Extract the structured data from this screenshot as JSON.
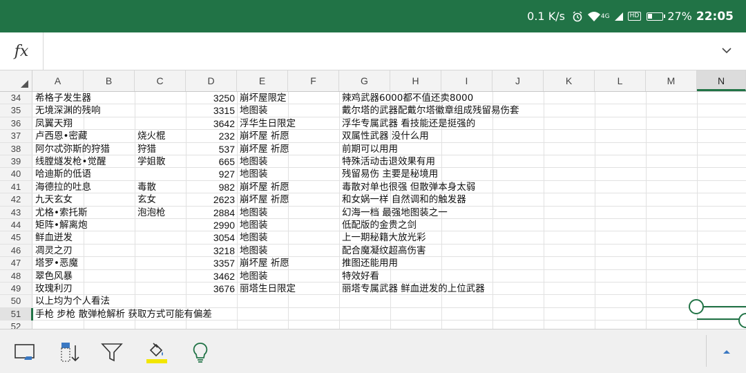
{
  "status_bar": {
    "network_speed": "0.1 K/s",
    "alarm_icon": "alarm-icon",
    "wifi_icon": "wifi-icon",
    "signal_label": "4G",
    "hd_label": "HD",
    "battery": "27%",
    "time": "22:05"
  },
  "formula_bar": {
    "fx_label": "fx",
    "value": "",
    "expand_icon": "chevron-down-icon"
  },
  "columns": [
    "A",
    "B",
    "C",
    "D",
    "E",
    "F",
    "G",
    "H",
    "I",
    "J",
    "K",
    "L",
    "M",
    "N"
  ],
  "selected_column": "N",
  "rows": [
    {
      "num": "34",
      "a": "希格子发生器",
      "c": "",
      "d": "3250",
      "e": "崩坏屋限定",
      "g": "辣鸡武器6000都不值还卖8000"
    },
    {
      "num": "35",
      "a": "无境深渊的残响",
      "c": "",
      "d": "3315",
      "e": "地图装",
      "g": "戴尔塔的武器配戴尔塔徽章组成残留易伤套"
    },
    {
      "num": "36",
      "a": "凤翼天翔",
      "c": "",
      "d": "3642",
      "e": "浮华生日限定",
      "g": "浮华专属武器 看技能还是挺强的"
    },
    {
      "num": "37",
      "a": "卢西恩•密藏",
      "c": "烧火棍",
      "d": "232",
      "e": "崩坏屋 祈愿",
      "g": "双属性武器 没什么用"
    },
    {
      "num": "38",
      "a": "阿尔忒弥斯的狩猎",
      "c": "狩猎",
      "d": "537",
      "e": "崩坏屋 祈愿",
      "g": "前期可以用用"
    },
    {
      "num": "39",
      "a": "线膛燧发枪•觉醒",
      "c": "学姐散",
      "d": "665",
      "e": "地图装",
      "g": "特殊活动击退效果有用"
    },
    {
      "num": "40",
      "a": "哈迪斯的低语",
      "c": "",
      "d": "927",
      "e": "地图装",
      "g": "残留易伤 主要是秘境用"
    },
    {
      "num": "41",
      "a": "海德拉的吐息",
      "c": "毒散",
      "d": "982",
      "e": "崩坏屋 祈愿",
      "g": "毒散对单也很强 但散弹本身太弱"
    },
    {
      "num": "42",
      "a": "九天玄女",
      "c": "玄女",
      "d": "2623",
      "e": "崩坏屋 祈愿",
      "g": "和女娲一样 自然调和的触发器"
    },
    {
      "num": "43",
      "a": "尤格•索托斯",
      "c": "泡泡枪",
      "d": "2884",
      "e": "地图装",
      "g": "幻海一档 最强地图装之一"
    },
    {
      "num": "44",
      "a": "矩阵•解离炮",
      "c": "",
      "d": "2990",
      "e": "地图装",
      "g": "低配版的金贵之剑"
    },
    {
      "num": "45",
      "a": "鲜血迸发",
      "c": "",
      "d": "3054",
      "e": "地图装",
      "g": "上一期秘籍大放光彩"
    },
    {
      "num": "46",
      "a": "凋灵之刃",
      "c": "",
      "d": "3218",
      "e": "地图装",
      "g": "配合魔凝纹超高伤害"
    },
    {
      "num": "47",
      "a": "塔罗•恶魔",
      "c": "",
      "d": "3357",
      "e": "崩坏屋 祈愿",
      "g": "推图还能用用"
    },
    {
      "num": "48",
      "a": "翠色风暴",
      "c": "",
      "d": "3462",
      "e": "地图装",
      "g": "特效好看"
    },
    {
      "num": "49",
      "a": "玫瑰利刃",
      "c": "",
      "d": "3676",
      "e": "丽塔生日限定",
      "g": "丽塔专属武器 鲜血迸发的上位武器"
    },
    {
      "num": "50",
      "a": "以上均为个人看法",
      "c": "",
      "d": "",
      "e": "",
      "g": ""
    },
    {
      "num": "51",
      "a": "手枪 步枪 散弹枪解析 获取方式可能有偏差",
      "c": "",
      "d": "",
      "e": "",
      "g": ""
    },
    {
      "num": "52",
      "a": "",
      "c": "",
      "d": "",
      "e": "",
      "g": ""
    }
  ],
  "active_row": "51",
  "toolbar": {
    "buttons": [
      {
        "name": "keyboard-cell-icon"
      },
      {
        "name": "sort-icon"
      },
      {
        "name": "filter-icon"
      },
      {
        "name": "fill-color-icon",
        "accent": "#f2e600"
      },
      {
        "name": "tell-me-lightbulb-icon",
        "accent": "#217346"
      }
    ],
    "collapse_icon": "caret-up-icon"
  },
  "colors": {
    "accent": "#217346",
    "highlight": "#f2e600"
  }
}
